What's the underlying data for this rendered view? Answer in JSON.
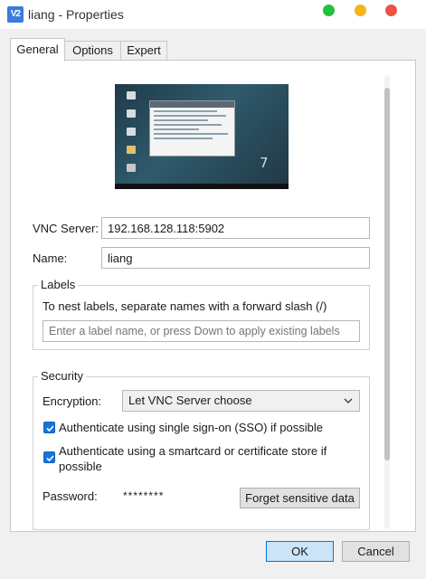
{
  "window": {
    "title": "liang - Properties",
    "icon_text": "V2"
  },
  "tabs": [
    {
      "label": "General",
      "active": true
    },
    {
      "label": "Options",
      "active": false
    },
    {
      "label": "Expert",
      "active": false
    }
  ],
  "general": {
    "vnc_server_label": "VNC Server:",
    "vnc_server_value": "192.168.128.118:5902",
    "name_label": "Name:",
    "name_value": "liang",
    "labels_section": {
      "title": "Labels",
      "hint": "To nest labels, separate names with a forward slash (/)",
      "input_placeholder": "Enter a label name, or press Down to apply existing labels"
    },
    "security_section": {
      "title": "Security",
      "encryption_label": "Encryption:",
      "encryption_value": "Let VNC Server choose",
      "sso_label": "Authenticate using single sign-on (SSO) if possible",
      "sso_checked": true,
      "smartcard_label_line1": "Authenticate using a smartcard or certificate store if",
      "smartcard_label_line2": "possible",
      "smartcard_checked": true,
      "password_label": "Password:",
      "password_value": "********",
      "forget_button": "Forget sensitive data"
    }
  },
  "footer": {
    "ok_label": "OK",
    "cancel_label": "Cancel"
  },
  "colors": {
    "accent": "#0078d7",
    "checkbox": "#1a73d9",
    "close": "#ee5346",
    "minimize": "#f6b318",
    "maximize": "#21c33c"
  }
}
